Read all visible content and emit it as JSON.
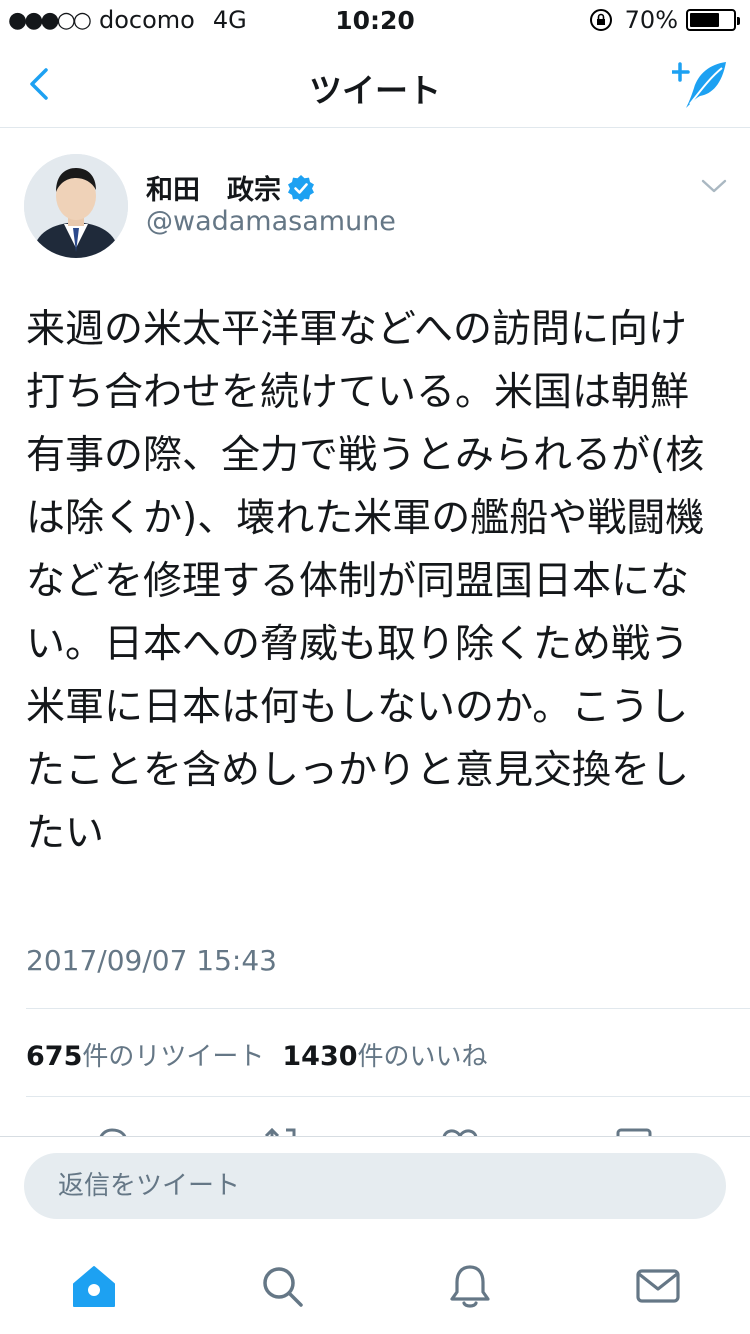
{
  "status_bar": {
    "signal": "●●●○○",
    "carrier": "docomo",
    "network": "4G",
    "time": "10:20",
    "battery_percent": "70%",
    "battery_level": 0.7
  },
  "nav": {
    "title": "ツイート"
  },
  "tweet": {
    "display_name": "和田　政宗",
    "handle": "@wadamasamune",
    "text": "来週の米太平洋軍などへの訪問に向け打ち合わせを続けている。米国は朝鮮有事の際、全力で戦うとみられるが(核は除くか)、壊れた米軍の艦船や戦闘機などを修理する体制が同盟国日本にない。日本への脅威も取り除くため戦う米軍に日本は何もしないのか。こうしたことを含めしっかりと意見交換をしたい",
    "timestamp": "2017/09/07 15:43",
    "retweet_count": "675",
    "retweet_label": "件のリツイート",
    "like_count": "1430",
    "like_label": "件のいいね"
  },
  "reply": {
    "placeholder": "返信をツイート"
  },
  "icons": {
    "back": "chevron-left-icon",
    "compose": "compose-tweet-icon",
    "verified": "verified-badge-icon",
    "caret": "chevron-down-icon",
    "tabs": [
      "home-icon",
      "search-icon",
      "notifications-icon",
      "messages-icon"
    ]
  },
  "colors": {
    "accent": "#1da1f2",
    "secondary_text": "#657786",
    "inactive_icon": "#657786"
  }
}
